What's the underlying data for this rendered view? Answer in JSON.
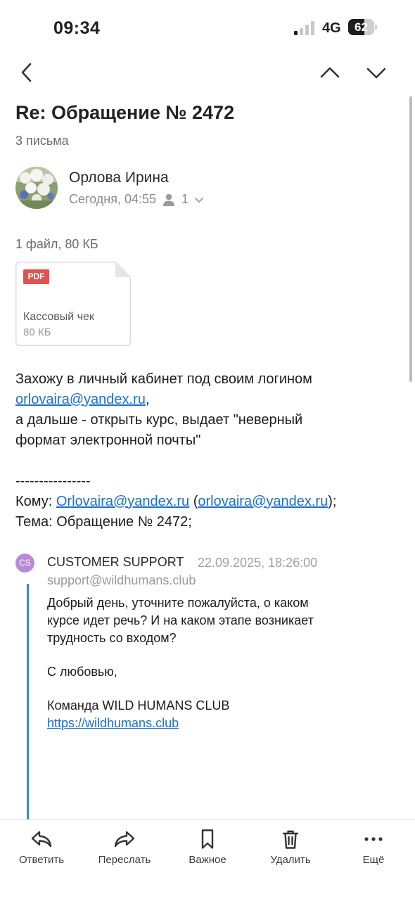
{
  "status_bar": {
    "time": "09:34",
    "network": "4G",
    "battery": "62"
  },
  "thread": {
    "subject": "Re: Обращение № 2472",
    "count": "3 письма"
  },
  "message": {
    "sender": "Орлова Ирина",
    "date": "Сегодня, 04:55",
    "recipients_count": "1",
    "files_summary": "1 файл, 80 КБ",
    "attachment": {
      "type_badge": "PDF",
      "name": "Кассовый чек",
      "size": "80 КБ"
    },
    "body": {
      "line1": "Захожу в личный кабинет под своим логином",
      "email_link": "orlovaira@yandex.ru",
      "comma": ",",
      "line3": "а дальше - открыть курс, выдает  \"неверный",
      "line4": "формат электронной почты\"",
      "separator": "----------------",
      "to_label": "Кому: ",
      "to_link1": "Orlovaira@yandex.ru",
      "to_paren_open": " (",
      "to_link2": "orlovaira@yandex.ru",
      "to_paren_close": ");",
      "subject_line": "Тема: Обращение № 2472;"
    }
  },
  "quoted": {
    "avatar_initials": "CS",
    "sender": "CUSTOMER SUPPORT",
    "date": "22.09.2025, 18:26:00",
    "email": "support@wildhumans.club",
    "text_line1": "Добрый день, уточните пожалуйста, о каком",
    "text_line2": "курсе идет речь? И на каком этапе возникает",
    "text_line3": "трудность со входом?",
    "sign1": "С любовью,",
    "sign2": "Команда WILD HUMANS CLUB",
    "link": "https://wildhumans.club"
  },
  "toolbar": {
    "reply": "Ответить",
    "forward": "Переслать",
    "important": "Важное",
    "delete": "Удалить",
    "more": "Ещё"
  },
  "colors": {
    "link": "#1a6fd1",
    "quote_bar": "#3b82e6",
    "pdf_badge": "#e25252",
    "avatar_cs": "#b98bd6"
  },
  "icons": [
    "back-icon",
    "chevron-up-icon",
    "chevron-down-icon",
    "person-icon",
    "reply-icon",
    "forward-icon",
    "bookmark-icon",
    "trash-icon",
    "more-icon"
  ]
}
